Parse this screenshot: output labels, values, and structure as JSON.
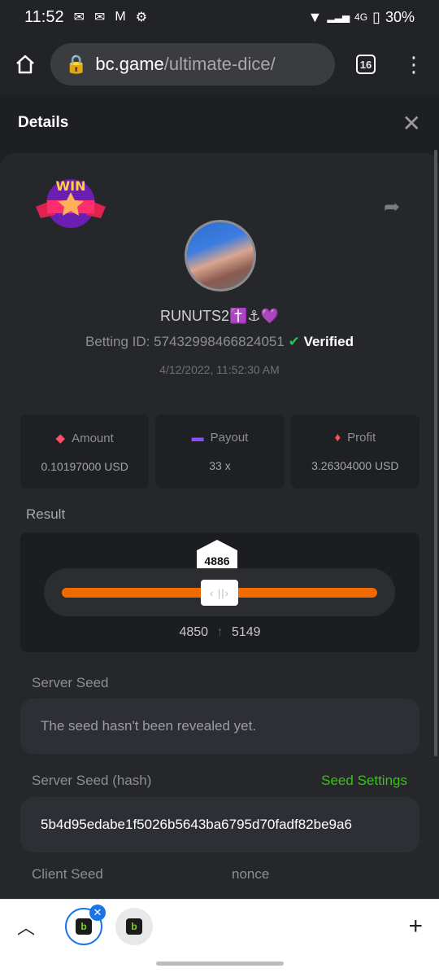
{
  "status": {
    "time": "11:52",
    "network": "4G",
    "battery": "30%"
  },
  "browser": {
    "domain": "bc.game",
    "path": "/ultimate-dice/",
    "tab_count": "16"
  },
  "dialog": {
    "title": "Details"
  },
  "bet": {
    "win_label": "WIN",
    "username": "RUNUTS2✝️⚓💜",
    "betting_id_label": "Betting ID:",
    "betting_id": "57432998466824051",
    "verified": "Verified",
    "datetime": "4/12/2022, 11:52:30 AM"
  },
  "stats": [
    {
      "label": "Amount",
      "value": "0.10197000 USD",
      "icon": "amount-icon",
      "color": "#ff4d6a"
    },
    {
      "label": "Payout",
      "value": "33 x",
      "icon": "wallet-icon",
      "color": "#8a4dff"
    },
    {
      "label": "Profit",
      "value": "3.26304000 USD",
      "icon": "profit-icon",
      "color": "#ff4d4d"
    }
  ],
  "result": {
    "title": "Result",
    "value": "4886",
    "range_low": "4850",
    "range_high": "5149"
  },
  "server_seed": {
    "label": "Server Seed",
    "value": "The seed hasn't been revealed yet."
  },
  "server_hash": {
    "label": "Server Seed (hash)",
    "settings": "Seed Settings",
    "value": "5b4d95edabe1f5026b5643ba6795d70fadf82be9a6"
  },
  "client": {
    "seed_label": "Client Seed",
    "nonce_label": "nonce"
  },
  "colors": {
    "accent": "#f06a00",
    "green": "#3bc117",
    "chrome_blue": "#1a73e8"
  }
}
